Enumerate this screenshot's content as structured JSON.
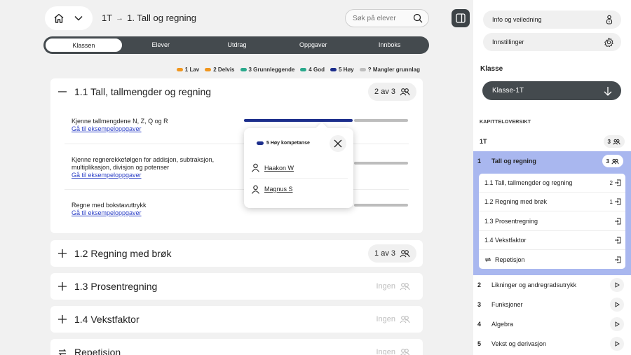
{
  "header": {
    "breadcrumb_class": "1T",
    "breadcrumb_arrow": "→",
    "breadcrumb_chapter": "1. Tall og regning",
    "search_placeholder": "Søk på elever"
  },
  "tabs": [
    {
      "label": "Klassen",
      "active": true
    },
    {
      "label": "Elever",
      "active": false
    },
    {
      "label": "Utdrag",
      "active": false
    },
    {
      "label": "Oppgaver",
      "active": false
    },
    {
      "label": "Innboks",
      "active": false
    }
  ],
  "legend": [
    {
      "label": "1 Lav",
      "color": "#f0961e"
    },
    {
      "label": "2 Delvis",
      "color": "#f0961e"
    },
    {
      "label": "3 Grunnleggende",
      "color": "#2aa98c"
    },
    {
      "label": "4 God",
      "color": "#2aa98c"
    },
    {
      "label": "5 Høy",
      "color": "#1c2e8c"
    },
    {
      "label": "? Mangler grunnlag",
      "color": "#bdbdbd"
    }
  ],
  "sections": [
    {
      "title": "1.1 Tall, tallmengder og regning",
      "count": "2 av 3",
      "expanded": true,
      "goals": [
        {
          "text": "Kjenne tallmengdene N, Z, Q og R",
          "link": "Gå til eksempeloppgaver",
          "high_fraction": 0.67
        },
        {
          "text": "Kjenne regnerekkefølgen for addisjon, subtraksjon, multiplikasjon, divisjon og potenser",
          "link": "Gå til eksempeloppgaver",
          "high_fraction": 0.67
        },
        {
          "text": "Regne med bokstavuttrykk",
          "link": "Gå til eksempeloppgaver",
          "high_fraction": 0.67
        }
      ]
    },
    {
      "title": "1.2 Regning med brøk",
      "count": "1 av 3",
      "expanded": false
    },
    {
      "title": "1.3 Prosentregning",
      "count": "Ingen",
      "expanded": false
    },
    {
      "title": "1.4 Vekstfaktor",
      "count": "Ingen",
      "expanded": false
    },
    {
      "title": "Repetisjon",
      "count": "Ingen",
      "expanded": false
    }
  ],
  "popover": {
    "title": "5 Høy kompetanse",
    "color": "#1c2e8c",
    "students": [
      "Haakon W",
      "Magnus S"
    ]
  },
  "sidebar": {
    "info_label": "Info og veiledning",
    "settings_label": "Innstillinger",
    "class_heading": "Klasse",
    "class_select": "Klasse-1T",
    "overview_heading": "KAPITTELOVERSIKT",
    "class_row": {
      "label": "1T",
      "count": "3"
    },
    "active_chapter": {
      "num": "1",
      "label": "Tall og regning",
      "count": "3"
    },
    "subchapters": [
      {
        "label": "1.1 Tall, tallmengder og regning",
        "count": "2"
      },
      {
        "label": "1.2 Regning med brøk",
        "count": "1"
      },
      {
        "label": "1.3 Prosentregning",
        "count": ""
      },
      {
        "label": "1.4 Vekstfaktor",
        "count": ""
      },
      {
        "label": "Repetisjon",
        "count": ""
      }
    ],
    "chapters": [
      {
        "num": "2",
        "label": "Likninger og andregradsutrykk"
      },
      {
        "num": "3",
        "label": "Funksjoner"
      },
      {
        "num": "4",
        "label": "Algebra"
      },
      {
        "num": "5",
        "label": "Vekst og derivasjon"
      }
    ]
  },
  "colors": {
    "high": "#1c2e8c",
    "missing": "#bdbdbd",
    "dark": "#444a4e",
    "selected": "#a9b7ef"
  }
}
